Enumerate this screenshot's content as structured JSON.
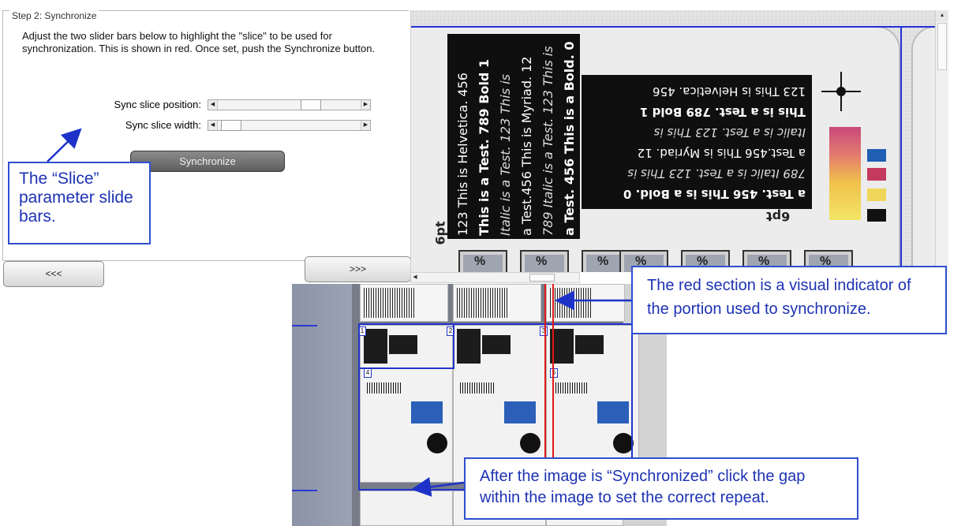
{
  "step": {
    "title": "Step 2: Synchronize",
    "instructions": "Adjust the two slider bars below to highlight the \"slice\" to be used for synchronization.  This is shown in red.  Once set, push the Synchronize button.",
    "sliders": [
      {
        "label": "Sync slice position:",
        "value_fraction": 0.68
      },
      {
        "label": "Sync slice width:",
        "value_fraction": 0.02
      }
    ],
    "synchronize_label": "Synchronize"
  },
  "nav": {
    "prev_label": "<<<",
    "next_label": ">>>"
  },
  "annotations": {
    "slice": "The “Slice” parameter slide bars.",
    "red_section": "The red section is a visual indicator of the portion used to synchronize.",
    "repeat": "After the image is “Synchronized” click the gap within the image to set the correct repeat."
  },
  "preview": {
    "vertical_lines": [
      "123 This is Helvetica. 456",
      "This is a Test. 789 Bold 1",
      "Italic is a Test. 123 This is",
      "a Test.456 This is Myriad. 12",
      "789 Italic is a Test. 123 This is",
      "a Test. 456 This is a Bold. 0"
    ],
    "flipped_lines": [
      "a Test. 456 This is a Bold. 0",
      "789 Italic is a Test. 123 This is",
      "a Test.456 This is Myriad. 12",
      "Italic is a Test. 123 This is",
      "This is a Test. 789 Bold 1",
      "123 This is Helvetica. 456"
    ],
    "pt_label_left": "6pt",
    "pt_label_right": "6pt",
    "pct_label": "%",
    "swatch_colors": [
      "#1f5fb3",
      "#c43a5e",
      "#efd65a",
      "#111111"
    ],
    "guide_color": "#2231d6",
    "indicator_color": "#e01818",
    "annotation_color": "#1d32b5"
  },
  "strip": {
    "tile_numbers": [
      "1",
      "2",
      "3",
      "4",
      "5",
      "6"
    ]
  },
  "icons": {
    "slider_left": "◀",
    "slider_right": "▶",
    "scroll_up": "▲",
    "scroll_left": "◀"
  }
}
